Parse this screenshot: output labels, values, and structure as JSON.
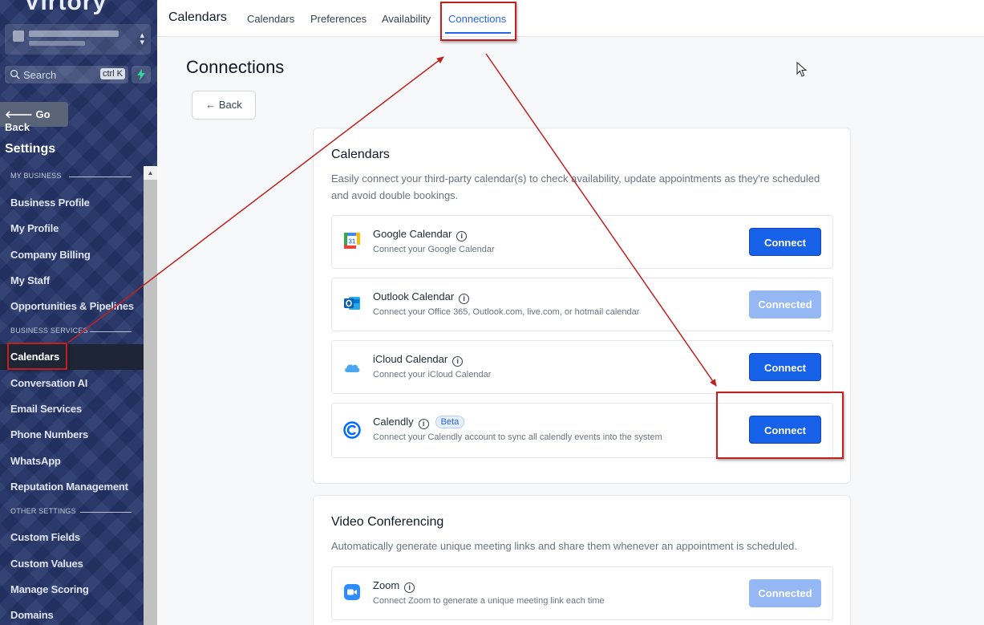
{
  "sidebar": {
    "logo": "Virtory",
    "search_placeholder": "Search",
    "search_shortcut": "ctrl K",
    "go_back": "Go Back",
    "settings_title": "Settings",
    "sections": {
      "my_business": "MY BUSINESS",
      "business_services": "BUSINESS SERVICES",
      "other_settings": "OTHER SETTINGS"
    },
    "items": {
      "business_profile": "Business Profile",
      "my_profile": "My Profile",
      "company_billing": "Company Billing",
      "my_staff": "My Staff",
      "opportunities": "Opportunities & Pipelines",
      "calendars": "Calendars",
      "conversation_ai": "Conversation AI",
      "email_services": "Email Services",
      "phone_numbers": "Phone Numbers",
      "whatsapp": "WhatsApp",
      "reputation": "Reputation Management",
      "custom_fields": "Custom Fields",
      "custom_values": "Custom Values",
      "manage_scoring": "Manage Scoring",
      "domains": "Domains"
    }
  },
  "topbar": {
    "title": "Calendars",
    "tabs": {
      "calendars": "Calendars",
      "preferences": "Preferences",
      "availability": "Availability",
      "connections": "Connections"
    }
  },
  "main": {
    "title": "Connections",
    "back": "Back",
    "calendars_card": {
      "title": "Calendars",
      "description": "Easily connect your third-party calendar(s) to check availability, update appointments as they're scheduled and avoid double bookings.",
      "rows": [
        {
          "name": "Google Calendar",
          "desc": "Connect your Google Calendar",
          "button": "Connect"
        },
        {
          "name": "Outlook Calendar",
          "desc": "Connect your Office 365, Outlook.com, live.com, or hotmail calendar",
          "button": "Connected"
        },
        {
          "name": "iCloud Calendar",
          "desc": "Connect your iCloud Calendar",
          "button": "Connect"
        },
        {
          "name": "Calendly",
          "badge": "Beta",
          "desc": "Connect your Calendly account to sync all calendly events into the system",
          "button": "Connect"
        }
      ]
    },
    "video_card": {
      "title": "Video Conferencing",
      "description": "Automatically generate unique meeting links and share them whenever an appointment is scheduled.",
      "rows": [
        {
          "name": "Zoom",
          "desc": "Connect Zoom to generate a unique meeting link each time",
          "button": "Connected"
        }
      ]
    }
  },
  "icons": {
    "google": "google-calendar-icon",
    "outlook": "outlook-icon",
    "icloud": "icloud-icon",
    "calendly": "calendly-icon",
    "zoom": "zoom-icon"
  },
  "colors": {
    "primary": "#1760e8",
    "connected": "#95b8f5",
    "annotation": "#c0201e",
    "sidebar": "#25366a"
  }
}
